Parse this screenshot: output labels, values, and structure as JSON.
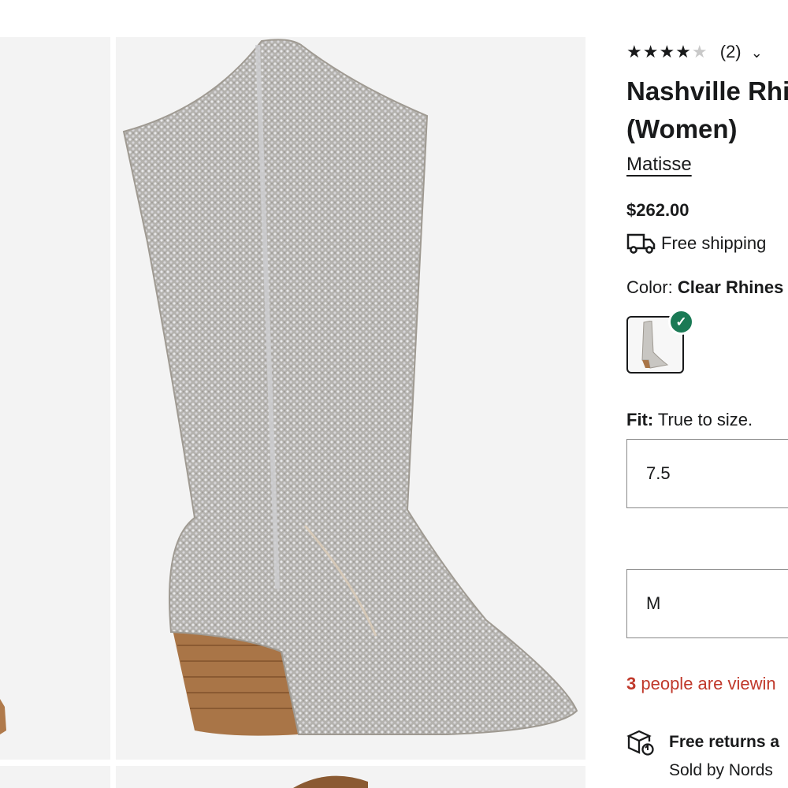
{
  "product": {
    "rating_stars": {
      "full": "★★★★",
      "empty": "★"
    },
    "rating_value": 4,
    "rating_count": "(2)",
    "rating_chevron": "⌄",
    "title_line1": "Nashville Rhi",
    "title_line2": "(Women)",
    "brand": "Matisse",
    "price": "$262.00",
    "shipping": "Free shipping",
    "color_label": "Color:",
    "color_value": "Clear Rhines",
    "fit_label": "Fit:",
    "fit_value": "True to size.",
    "size_value": "7.5",
    "width_value": "M",
    "viewing_count": "3",
    "viewing_text": " people are viewin",
    "returns_title": "Free returns a",
    "sold_by": "Sold by Nords",
    "check_glyph": "✓"
  },
  "colors": {
    "accent_green": "#1a7a55",
    "urgency_red": "#c0392b",
    "text": "#191a1b",
    "image_bg": "#f3f3f3"
  },
  "icons": {
    "truck": "truck-icon",
    "returns": "returns-box-icon",
    "check": "check-icon",
    "chevron": "chevron-down-icon"
  }
}
